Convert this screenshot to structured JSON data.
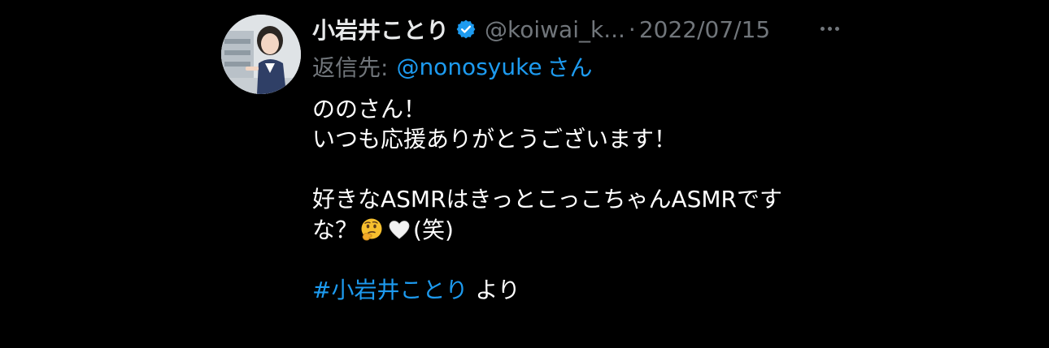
{
  "tweet": {
    "display_name": "小岩井ことり",
    "handle": "@koiwai_k...",
    "separator": "·",
    "date": "2022/07/15",
    "reply": {
      "prefix": "返信先:",
      "mention": "@nonosyuke",
      "suffix": "さん"
    },
    "body": {
      "line1": "ののさん！",
      "line2": "いつも応援ありがとうございます！",
      "line3": "好きなASMRはきっとこっこちゃんASMRです",
      "line4_start": "な？",
      "line4_end": "(笑)",
      "hashtag": "#小岩井ことり",
      "hashtag_suffix": " より"
    },
    "icons": {
      "verified": "verified-badge-icon",
      "more": "more-options-icon",
      "emoji_1": "thinking-face-emoji",
      "emoji_2": "white-heart-emoji"
    },
    "colors": {
      "background": "#000000",
      "text": "#ffffff",
      "secondary": "#71767b",
      "accent": "#1d9bf0"
    }
  }
}
